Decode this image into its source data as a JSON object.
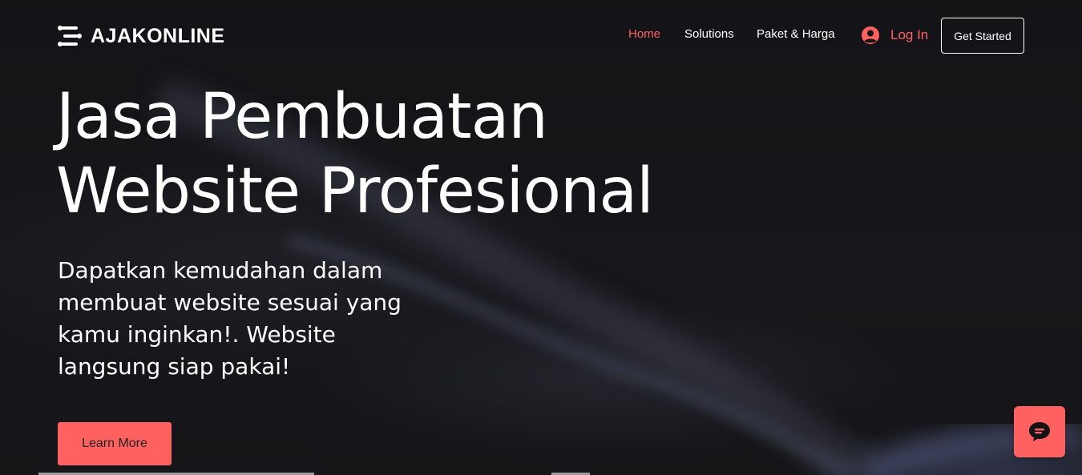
{
  "brand": {
    "name": "AJAKONLINE",
    "logo_icon": "stacked-lines-logo-icon"
  },
  "nav": {
    "items": [
      {
        "label": "Home",
        "active": true
      },
      {
        "label": "Solutions",
        "active": false
      },
      {
        "label": "Paket & Harga",
        "active": false
      }
    ],
    "login_label": "Log In",
    "login_icon": "user-avatar-icon",
    "cta_label": "Get Started"
  },
  "hero": {
    "title_line1": "Jasa Pembuatan",
    "title_line2": "Website Profesional",
    "subtitle": "Dapatkan kemudahan dalam membuat website sesuai yang kamu inginkan!. Website langsung siap pakai!",
    "button_label": "Learn More"
  },
  "chat": {
    "icon": "chat-bubble-icon"
  },
  "colors": {
    "accent": "#ff6161",
    "background": "#141417",
    "text": "#ffffff"
  }
}
